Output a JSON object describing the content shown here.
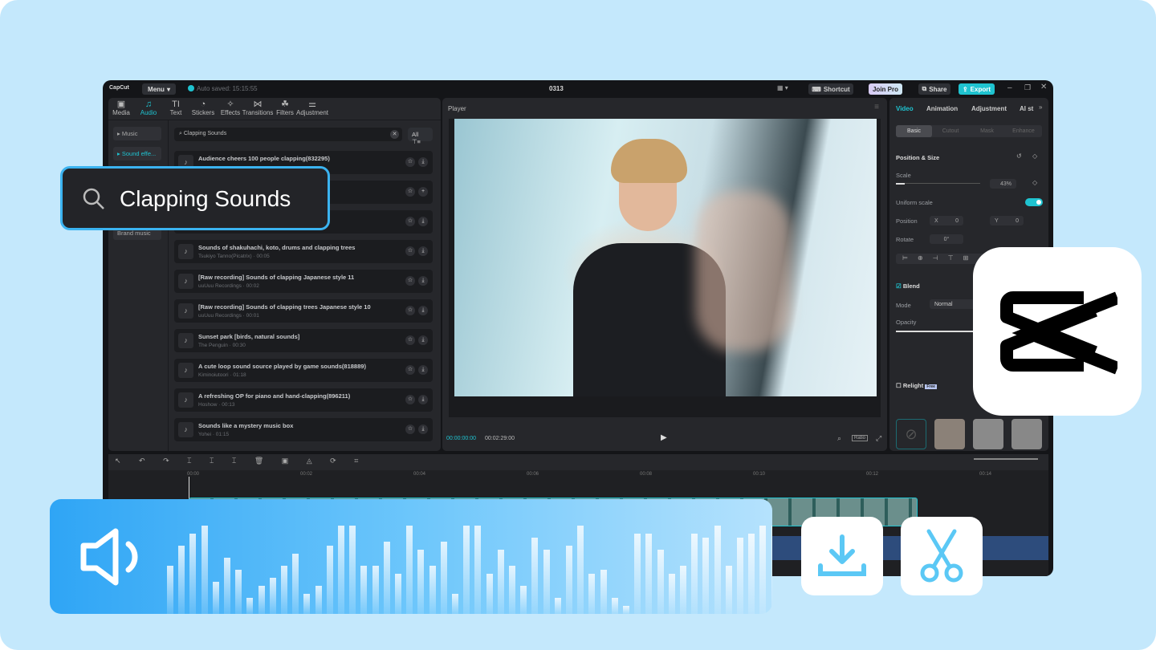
{
  "app": {
    "logo": "CapCut",
    "menu": "Menu",
    "autosave": "Auto saved: 15:15:55",
    "project_title": "0313",
    "shortcut": "Shortcut",
    "join_pro": "Join Pro",
    "share": "Share",
    "export": "Export",
    "accent": "#1fc3d0"
  },
  "media_tabs": [
    {
      "label": "Media",
      "icon": "media-icon"
    },
    {
      "label": "Audio",
      "icon": "audio-icon",
      "active": true
    },
    {
      "label": "Text",
      "icon": "text-icon"
    },
    {
      "label": "Stickers",
      "icon": "stickers-icon"
    },
    {
      "label": "Effects",
      "icon": "effects-icon"
    },
    {
      "label": "Transitions",
      "icon": "transitions-icon"
    },
    {
      "label": "Filters",
      "icon": "filters-icon"
    },
    {
      "label": "Adjustment",
      "icon": "adjustment-icon"
    }
  ],
  "categories": [
    "Music",
    "Sound effe...",
    "Brand music"
  ],
  "search": {
    "value": "Clapping Sounds",
    "filter": "All"
  },
  "callout": {
    "text": "Clapping Sounds"
  },
  "sounds": [
    {
      "title": "Audience cheers 100 people clapping(832295)",
      "meta": "",
      "action": "download"
    },
    {
      "title": "",
      "meta": "",
      "action": "add"
    },
    {
      "title": "",
      "meta": "",
      "action": "download"
    },
    {
      "title": "Sounds of shakuhachi, koto, drums and clapping trees",
      "meta": "Tsukiyo Tanno(Picatrix) · 00:05",
      "action": "download"
    },
    {
      "title": "[Raw recording] Sounds of clapping Japanese style 11",
      "meta": "uuUuu Recordings · 00:02",
      "action": "download"
    },
    {
      "title": "[Raw recording] Sounds of clapping trees Japanese style 10",
      "meta": "uuUuu Recordings · 00:01",
      "action": "download"
    },
    {
      "title": "Sunset park [birds, natural sounds]",
      "meta": "The Penguin · 00:30",
      "action": "download"
    },
    {
      "title": "A cute loop sound source played by game sounds(818889)",
      "meta": "Kiminoiutoori · 01:18",
      "action": "download"
    },
    {
      "title": "A refreshing OP for piano and hand-clapping(896211)",
      "meta": "Hoshow · 00:13",
      "action": "download"
    },
    {
      "title": "Sounds like a mystery music box",
      "meta": "Yohei · 01:15",
      "action": "download"
    }
  ],
  "player": {
    "title": "Player",
    "current": "00:00:00:00",
    "total": "00:02:29:00",
    "ratio": "Ratio"
  },
  "props": {
    "tabs": [
      "Video",
      "Animation",
      "Adjustment",
      "AI st"
    ],
    "subtabs": [
      "Basic",
      "Cutout",
      "Mask",
      "Enhance"
    ],
    "position_size": "Position & Size",
    "scale_label": "Scale",
    "scale_value": "43%",
    "scale_fraction": 0.43,
    "uniform": "Uniform scale",
    "position": "Position",
    "x_label": "X",
    "x": "0",
    "y_label": "Y",
    "y": "0",
    "rotate": "Rotate",
    "rotate_value": "0°",
    "blend": "Blend",
    "mode": "Mode",
    "mode_value": "Normal",
    "opacity": "Opacity",
    "relight": "Relight",
    "relight_badge": "Free"
  },
  "timeline": {
    "ticks": [
      "00:00",
      "00:02",
      "00:04",
      "00:06",
      "00:08",
      "00:10",
      "00:12",
      "00:14"
    ]
  }
}
